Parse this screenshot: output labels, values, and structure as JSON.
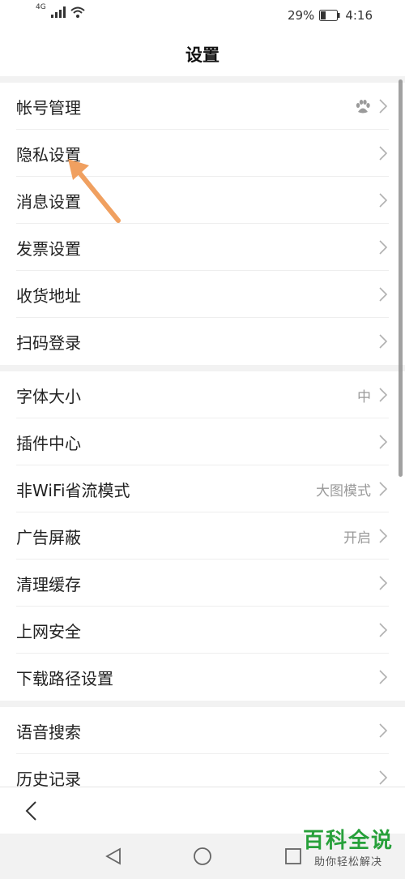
{
  "status_bar": {
    "network": "4G",
    "battery_percent": "29%",
    "time": "4:16"
  },
  "header": {
    "title": "设置"
  },
  "groups": [
    {
      "items": [
        {
          "label": "帐号管理",
          "value": "",
          "icon": "paw-icon"
        },
        {
          "label": "隐私设置",
          "value": ""
        },
        {
          "label": "消息设置",
          "value": ""
        },
        {
          "label": "发票设置",
          "value": ""
        },
        {
          "label": "收货地址",
          "value": ""
        },
        {
          "label": "扫码登录",
          "value": ""
        }
      ]
    },
    {
      "items": [
        {
          "label": "字体大小",
          "value": "中"
        },
        {
          "label": "插件中心",
          "value": ""
        },
        {
          "label": "非WiFi省流模式",
          "value": "大图模式"
        },
        {
          "label": "广告屏蔽",
          "value": "开启"
        },
        {
          "label": "清理缓存",
          "value": ""
        },
        {
          "label": "上网安全",
          "value": ""
        },
        {
          "label": "下载路径设置",
          "value": ""
        }
      ]
    },
    {
      "items": [
        {
          "label": "语音搜索",
          "value": ""
        },
        {
          "label": "历史记录",
          "value": ""
        }
      ]
    }
  ],
  "annotation": {
    "arrow_color": "#f0a060",
    "target": "隐私设置"
  },
  "watermark": {
    "title": "百科全说",
    "subtitle": "助你轻松解决"
  },
  "colors": {
    "watermark_green": "#27a03a",
    "value_gray": "#9a9a9a"
  }
}
